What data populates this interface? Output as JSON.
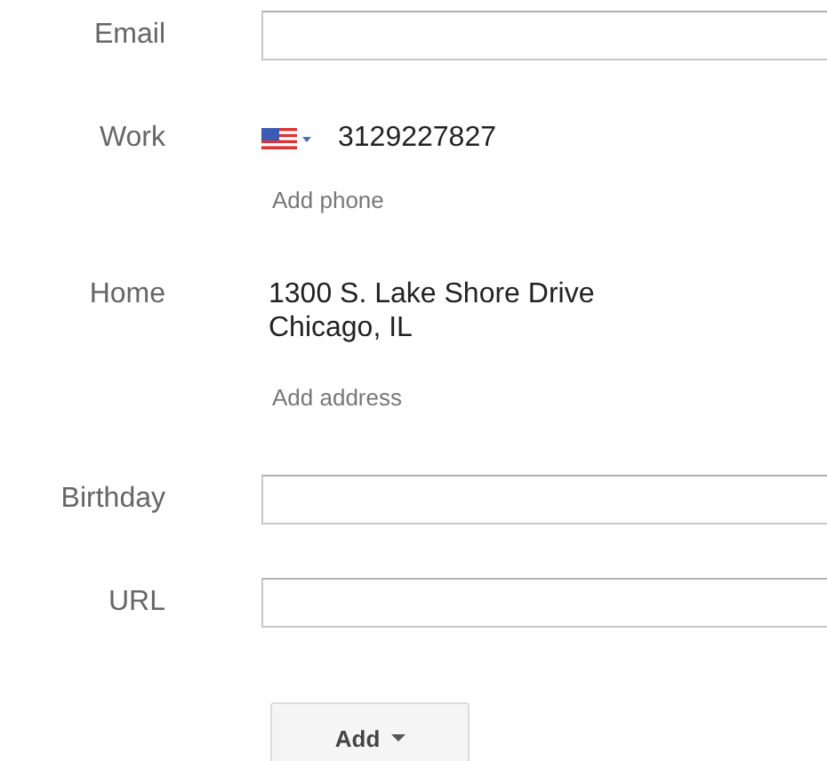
{
  "fields": [
    {
      "kind": "input",
      "label": "Email"
    },
    {
      "kind": "phone",
      "label": "Work",
      "value": "3129227827",
      "action": "Add phone"
    },
    {
      "kind": "address",
      "label": "Home",
      "lines": [
        "1300 S. Lake Shore Drive",
        "Chicago, IL"
      ],
      "action": "Add address"
    },
    {
      "kind": "input",
      "label": "Birthday"
    },
    {
      "kind": "input",
      "label": "URL"
    }
  ],
  "add_button": {
    "label": "Add"
  }
}
